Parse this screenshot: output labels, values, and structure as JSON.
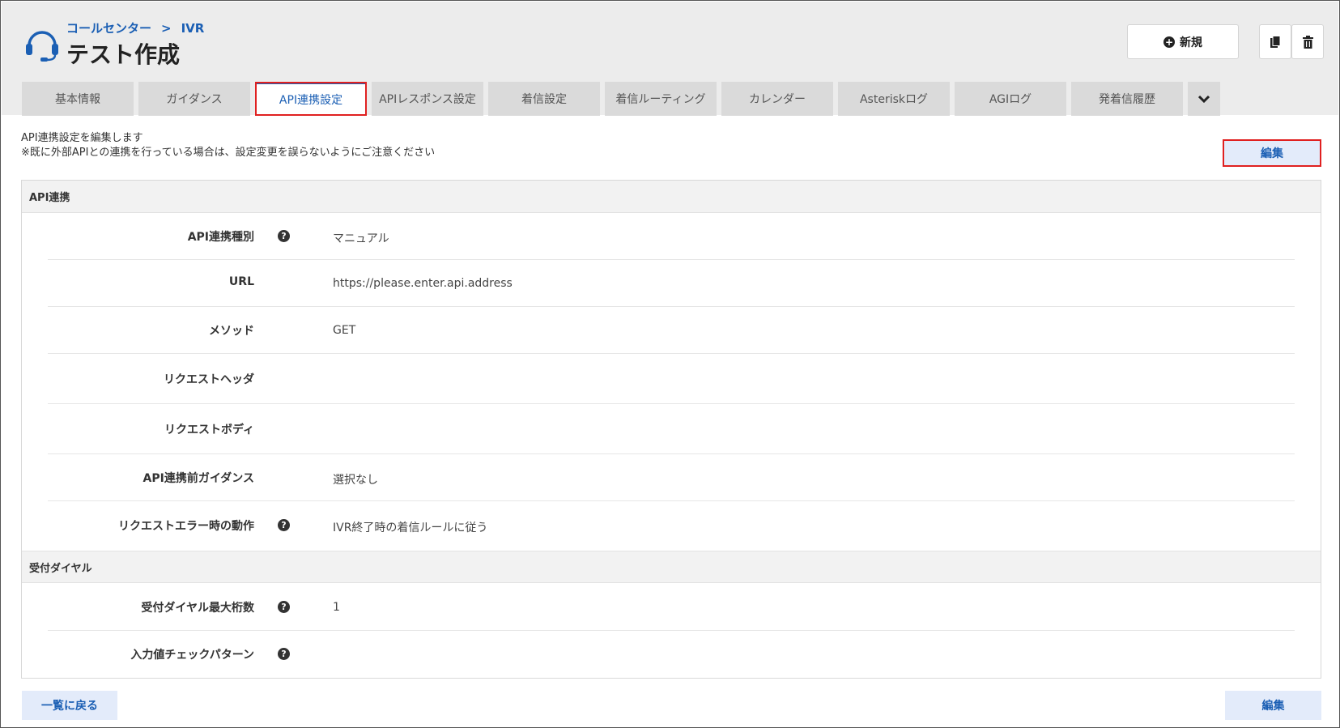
{
  "header": {
    "breadcrumb": [
      "コールセンター",
      "IVR"
    ],
    "breadcrumb_separator": ">",
    "title": "テスト作成",
    "new_button": "新規",
    "icons": {
      "app": "headset-icon",
      "new": "plus-circle-icon",
      "copy": "copy-icon",
      "delete": "trash-icon"
    }
  },
  "tabs": [
    {
      "label": "基本情報",
      "active": false
    },
    {
      "label": "ガイダンス",
      "active": false
    },
    {
      "label": "API連携設定",
      "active": true
    },
    {
      "label": "APIレスポンス設定",
      "active": false
    },
    {
      "label": "着信設定",
      "active": false
    },
    {
      "label": "着信ルーティング",
      "active": false
    },
    {
      "label": "カレンダー",
      "active": false
    },
    {
      "label": "Asteriskログ",
      "active": false
    },
    {
      "label": "AGIログ",
      "active": false
    },
    {
      "label": "発着信履歴",
      "active": false
    }
  ],
  "description": {
    "line1": "API連携設定を編集します",
    "line2": "※既に外部APIとの連携を行っている場合は、設定変更を誤らないようにご注意ください"
  },
  "edit_label": "編集",
  "back_label": "一覧に戻る",
  "sections": {
    "api": {
      "title": "API連携",
      "rows": [
        {
          "label": "API連携種別",
          "help": true,
          "value": "マニュアル"
        },
        {
          "label": "URL",
          "help": false,
          "value": "https://please.enter.api.address"
        },
        {
          "label": "メソッド",
          "help": false,
          "value": "GET"
        },
        {
          "label": "リクエストヘッダ",
          "help": false,
          "value": ""
        },
        {
          "label": "リクエストボディ",
          "help": false,
          "value": ""
        },
        {
          "label": "API連携前ガイダンス",
          "help": false,
          "value": "選択なし"
        },
        {
          "label": "リクエストエラー時の動作",
          "help": true,
          "value": "IVR終了時の着信ルールに従う"
        }
      ]
    },
    "dial": {
      "title": "受付ダイヤル",
      "rows": [
        {
          "label": "受付ダイヤル最大桁数",
          "help": true,
          "value": "1"
        },
        {
          "label": "入力値チェックパターン",
          "help": true,
          "value": ""
        }
      ]
    }
  },
  "help_glyph": "?",
  "colors": {
    "accent": "#1b5fb4",
    "highlight": "#e02020",
    "tab_bg": "#dadada",
    "header_bg": "#ececec",
    "button_bg": "#e3ebfa"
  }
}
